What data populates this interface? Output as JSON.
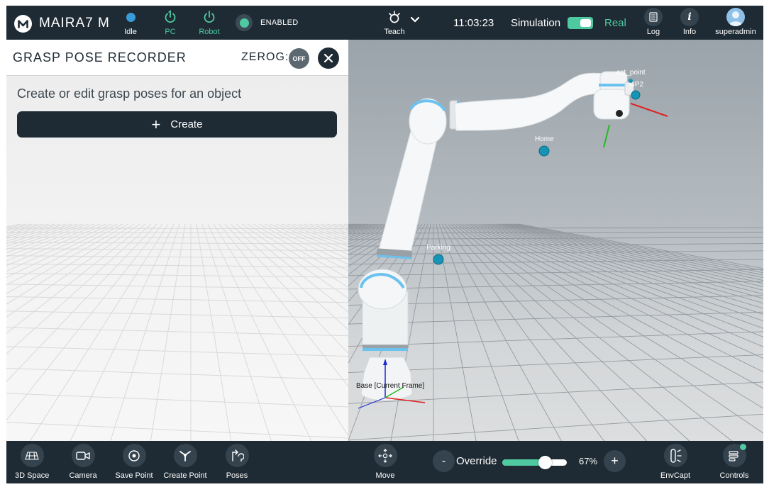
{
  "app": {
    "name": "MAIRA7 M"
  },
  "topbar": {
    "status_items": [
      {
        "label": "Idle",
        "icon": "status-dot-icon",
        "color": "#3a9bd9"
      },
      {
        "label": "PC",
        "icon": "power-icon"
      },
      {
        "label": "Robot",
        "icon": "power-icon"
      }
    ],
    "enabled_label": "ENABLED",
    "mode_label": "Teach",
    "mode_icon": "teach-icon",
    "time": "11:03:23",
    "simulation_label": "Simulation",
    "real_label": "Real",
    "simulation_mode": "Real",
    "log_label": "Log",
    "info_label": "Info",
    "user_label": "superadmin"
  },
  "panel": {
    "title": "GRASP POSE RECORDER",
    "zerog_label": "ZEROG:",
    "zerog_state": "OFF",
    "subtitle": "Create or edit grasp poses for an object",
    "create_label": "Create"
  },
  "viewport": {
    "points": [
      {
        "label": "Home"
      },
      {
        "label": "Parking"
      },
      {
        "label": "GP2"
      },
      {
        "label": "TCP_point_partial",
        "visible_text": "ect_point"
      }
    ],
    "base_frame_label": "Base [Current Frame]"
  },
  "bottombar": {
    "tools": [
      {
        "label": "3D Space",
        "icon": "grid-3d-icon"
      },
      {
        "label": "Camera",
        "icon": "camera-icon"
      },
      {
        "label": "Save Point",
        "icon": "target-icon"
      },
      {
        "label": "Create Point",
        "icon": "create-point-icon"
      },
      {
        "label": "Poses",
        "icon": "poses-icon"
      }
    ],
    "move_label": "Move",
    "override_label": "Override",
    "override_minus": "-",
    "override_plus": "+",
    "override_value": "67%",
    "override_fraction": 0.67,
    "envcapt_label": "EnvCapt",
    "controls_label": "Controls"
  },
  "colors": {
    "bar_bg": "#1f2b34",
    "accent_green": "#4ec9a0",
    "accent_blue": "#3a9bd9",
    "robot_ring": "#6cc2ee",
    "point_teal": "#1793b5"
  }
}
